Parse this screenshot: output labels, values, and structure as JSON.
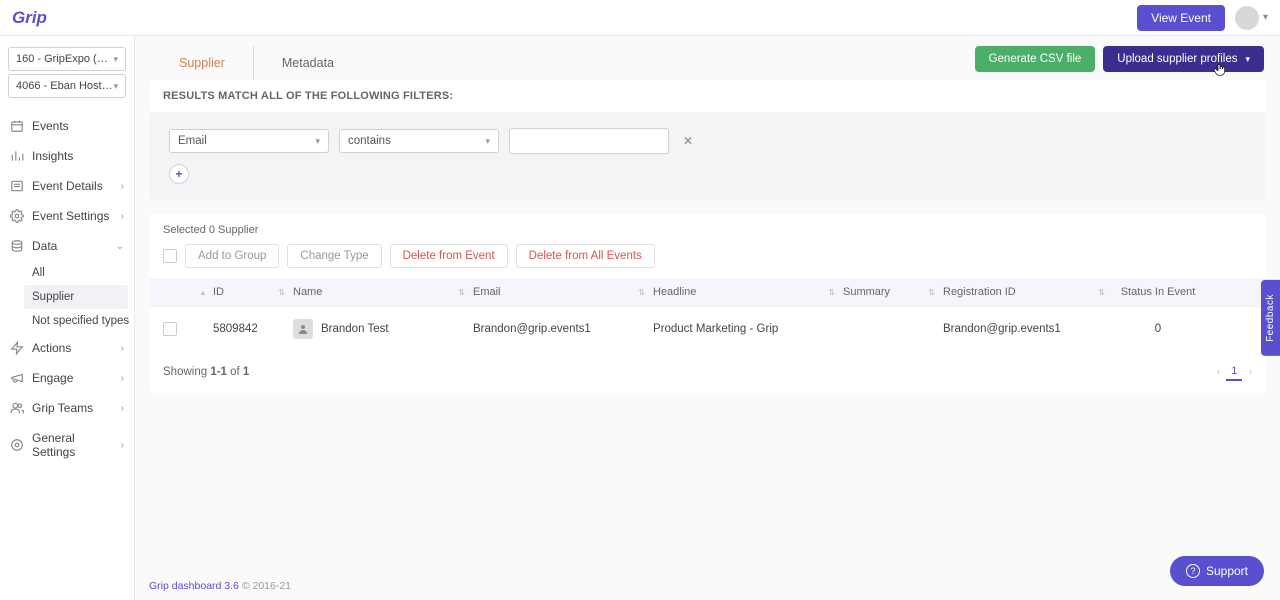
{
  "header": {
    "logo": "Grip",
    "view_event": "View Event"
  },
  "sidebar": {
    "selects": [
      {
        "label": "160 - GripExpo (prod..."
      },
      {
        "label": "4066 - Eban Hosted B..."
      }
    ],
    "nav": {
      "events": "Events",
      "insights": "Insights",
      "event_details": "Event Details",
      "event_settings": "Event Settings",
      "data": "Data",
      "actions": "Actions",
      "engage": "Engage",
      "grip_teams": "Grip Teams",
      "general_settings": "General Settings"
    },
    "data_sub": {
      "all": "All",
      "supplier": "Supplier",
      "not_specified": "Not specified types"
    }
  },
  "tabs": {
    "supplier": "Supplier",
    "metadata": "Metadata"
  },
  "actions": {
    "generate_csv": "Generate CSV file",
    "upload_profiles": "Upload supplier profiles"
  },
  "filters": {
    "heading": "RESULTS MATCH ALL OF THE FOLLOWING FILTERS:",
    "field": "Email",
    "operator": "contains",
    "value": "",
    "add": "+"
  },
  "table": {
    "selected_text": "Selected 0 Supplier",
    "btn_add_group": "Add to Group",
    "btn_change_type": "Change Type",
    "btn_delete_event": "Delete from Event",
    "btn_delete_all": "Delete from All Events",
    "cols": {
      "id": "ID",
      "name": "Name",
      "email": "Email",
      "headline": "Headline",
      "summary": "Summary",
      "reg_id": "Registration ID",
      "status": "Status In Event"
    },
    "row": {
      "id": "5809842",
      "name": "Brandon Test",
      "email": "Brandon@grip.events1",
      "headline": "Product Marketing - Grip",
      "summary": "",
      "reg_id": "Brandon@grip.events1",
      "status": "0"
    },
    "footer_showing": "Showing ",
    "footer_range": "1-1",
    "footer_of": " of ",
    "footer_total": "1",
    "page": "1"
  },
  "footer": {
    "brand": "Grip dashboard 3.6",
    "copy": " © 2016-21"
  },
  "feedback": "Feedback",
  "support": "Support"
}
